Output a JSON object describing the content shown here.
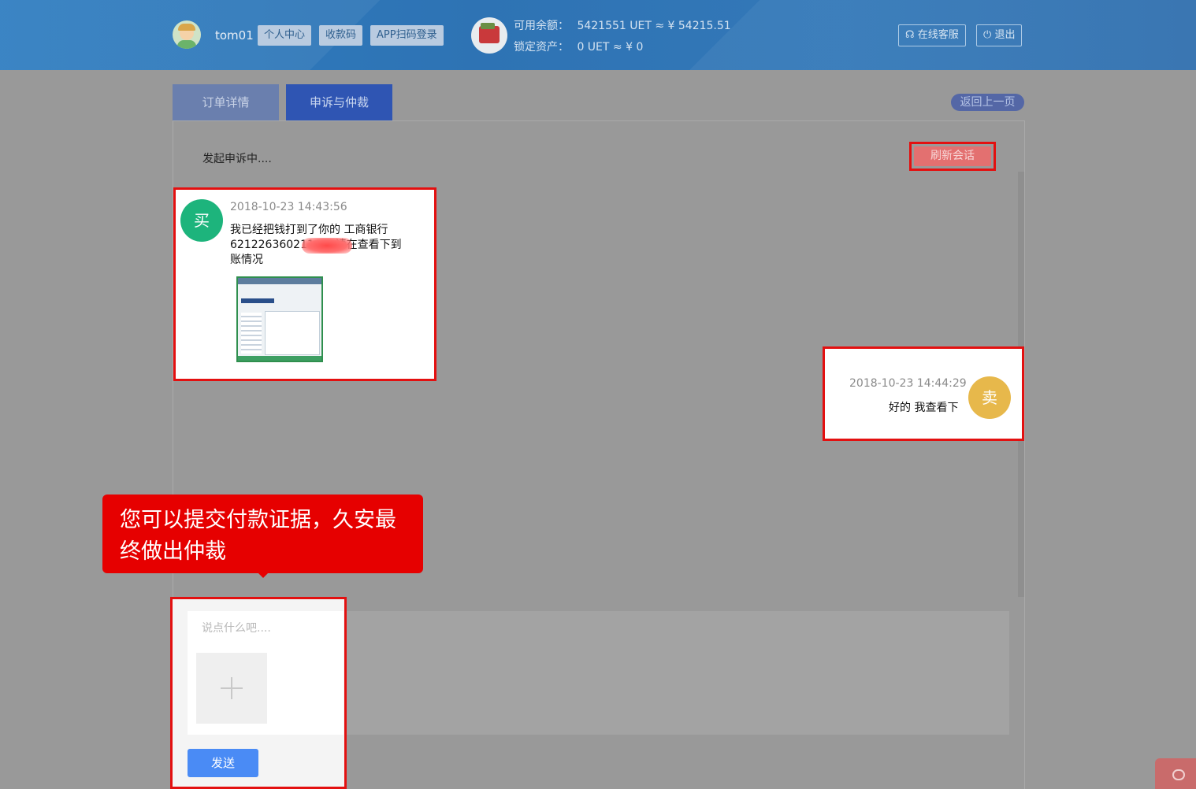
{
  "header": {
    "username": "tom01",
    "buttons": [
      "个人中心",
      "收款码",
      "APP扫码登录"
    ],
    "balance_label": "可用余额：",
    "balance_value": "5421551 UET ≈ ¥ 54215.51",
    "locked_label": "锁定资产：",
    "locked_value": "0 UET ≈ ¥ 0",
    "service_label": "在线客服",
    "logout_label": "退出"
  },
  "tabs": [
    {
      "label": "订单详情"
    },
    {
      "label": "申诉与仲裁"
    }
  ],
  "back_label": "返回上一页",
  "panel": {
    "status_text": "发起申诉中....",
    "refresh_label": "刷新会话"
  },
  "messages": [
    {
      "avatar_text": "买",
      "time": "2018-10-23 14:43:56",
      "text": "我已经把钱打到了你的 工商银行6212263602116        9 请在查看下到账情况"
    },
    {
      "avatar_text": "卖",
      "time": "2018-10-23 14:44:29",
      "text": "好的 我查看下"
    }
  ],
  "tooltip": "您可以提交付款证据，久安最终做出仲裁",
  "input": {
    "placeholder": "说点什么吧....",
    "send_label": "发送"
  },
  "colors": {
    "header_blue": "#2f7dc0",
    "highlight_red": "#e31010",
    "buyer_green": "#1db47c",
    "seller_yellow": "#e7b84b",
    "send_blue": "#4a8bf5"
  }
}
